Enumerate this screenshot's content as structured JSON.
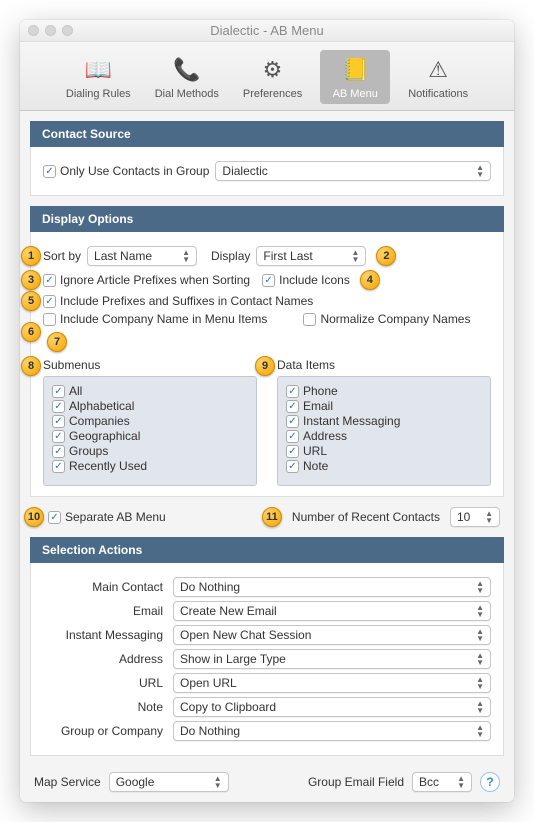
{
  "window": {
    "title": "Dialectic - AB Menu"
  },
  "toolbar": [
    {
      "label": "Dialing Rules",
      "icon": "📖"
    },
    {
      "label": "Dial Methods",
      "icon": "📞"
    },
    {
      "label": "Preferences",
      "icon": "⚙︎"
    },
    {
      "label": "AB Menu",
      "icon": "📒",
      "selected": true
    },
    {
      "label": "Notifications",
      "icon": "⚠︎"
    }
  ],
  "contactSource": {
    "header": "Contact Source",
    "onlyGroup": {
      "label": "Only Use Contacts in Group",
      "checked": true
    },
    "groupSelect": "Dialectic"
  },
  "displayOptions": {
    "header": "Display Options",
    "sortByLabel": "Sort by",
    "sortBy": "Last Name",
    "displayLabel": "Display",
    "display": "First Last",
    "ignoreArticle": {
      "label": "Ignore Article Prefixes when Sorting",
      "checked": true
    },
    "includeIcons": {
      "label": "Include Icons",
      "checked": true
    },
    "includePrefix": {
      "label": "Include Prefixes and Suffixes in Contact Names",
      "checked": true
    },
    "includeCompany": {
      "label": "Include Company Name in Menu Items",
      "checked": false
    },
    "normalizeCompany": {
      "label": "Normalize Company Names",
      "checked": false
    },
    "submenusLabel": "Submenus",
    "submenus": [
      "All",
      "Alphabetical",
      "Companies",
      "Geographical",
      "Groups",
      "Recently Used"
    ],
    "dataItemsLabel": "Data Items",
    "dataItems": [
      "Phone",
      "Email",
      "Instant Messaging",
      "Address",
      "URL",
      "Note"
    ],
    "separateAB": {
      "label": "Separate AB Menu",
      "checked": true
    },
    "recentLabel": "Number of Recent Contacts",
    "recentValue": "10",
    "badges": {
      "b1": "1",
      "b2": "2",
      "b3": "3",
      "b4": "4",
      "b5": "5",
      "b6": "6",
      "b7": "7",
      "b8": "8",
      "b9": "9",
      "b10": "10",
      "b11": "11"
    }
  },
  "selectionActions": {
    "header": "Selection Actions",
    "rows": [
      {
        "label": "Main Contact",
        "value": "Do Nothing"
      },
      {
        "label": "Email",
        "value": "Create New Email"
      },
      {
        "label": "Instant Messaging",
        "value": "Open New Chat Session"
      },
      {
        "label": "Address",
        "value": "Show in Large Type"
      },
      {
        "label": "URL",
        "value": "Open URL"
      },
      {
        "label": "Note",
        "value": "Copy to Clipboard"
      },
      {
        "label": "Group or Company",
        "value": "Do Nothing"
      }
    ],
    "mapServiceLabel": "Map Service",
    "mapService": "Google",
    "groupEmailLabel": "Group Email Field",
    "groupEmail": "Bcc"
  }
}
